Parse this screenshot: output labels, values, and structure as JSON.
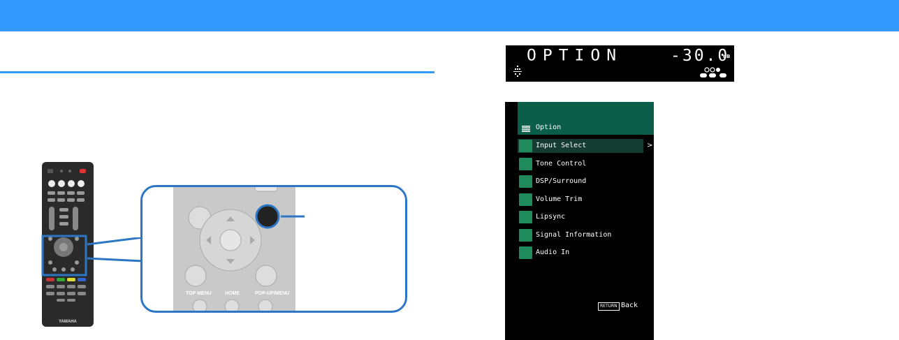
{
  "display": {
    "main_text": "OPTION",
    "volume": "-30.0",
    "unit": "dB"
  },
  "tv_menu": {
    "title": "Option",
    "items": [
      {
        "label": "Input Select",
        "selected": true,
        "icon": "input-icon"
      },
      {
        "label": "Tone Control",
        "selected": false,
        "icon": "tone-icon"
      },
      {
        "label": "DSP/Surround",
        "selected": false,
        "icon": "surround-icon"
      },
      {
        "label": "Volume Trim",
        "selected": false,
        "icon": "volume-icon"
      },
      {
        "label": "Lipsync",
        "selected": false,
        "icon": "lipsync-icon"
      },
      {
        "label": "Signal Information",
        "selected": false,
        "icon": "signal-icon"
      },
      {
        "label": "Audio In",
        "selected": false,
        "icon": "audio-icon"
      }
    ],
    "submenu_arrow": ">",
    "return_key": "RETURN",
    "back_label": "Back"
  },
  "remote": {
    "brand": "YAMAHA",
    "zoom_labels": {
      "top_menu": "TOP MENU",
      "home": "HOME",
      "popup_menu": "POP-UP/MENU"
    }
  },
  "colors": {
    "accent": "#3399ff",
    "zoom_frame": "#2b77c6",
    "tv_header": "#0b5e4a",
    "tv_icon": "#1f8a5c"
  }
}
